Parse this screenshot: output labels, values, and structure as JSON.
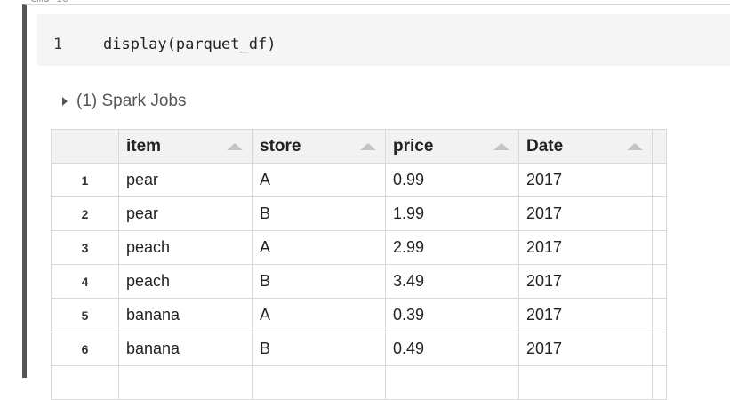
{
  "cell": {
    "line_number": "1",
    "code": "display(parquet_df)"
  },
  "spark_jobs": {
    "label": "(1) Spark Jobs",
    "icon": "caret-right-icon"
  },
  "table": {
    "columns": [
      "item",
      "store",
      "price",
      "Date"
    ],
    "sort_icon": "sort-ascending-icon",
    "rows": [
      {
        "num": "1",
        "item": "pear",
        "store": "A",
        "price": "0.99",
        "date": "2017"
      },
      {
        "num": "2",
        "item": "pear",
        "store": "B",
        "price": "1.99",
        "date": "2017"
      },
      {
        "num": "3",
        "item": "peach",
        "store": "A",
        "price": "2.99",
        "date": "2017"
      },
      {
        "num": "4",
        "item": "peach",
        "store": "B",
        "price": "3.49",
        "date": "2017"
      },
      {
        "num": "5",
        "item": "banana",
        "store": "A",
        "price": "0.39",
        "date": "2017"
      },
      {
        "num": "6",
        "item": "banana",
        "store": "B",
        "price": "0.49",
        "date": "2017"
      }
    ]
  }
}
